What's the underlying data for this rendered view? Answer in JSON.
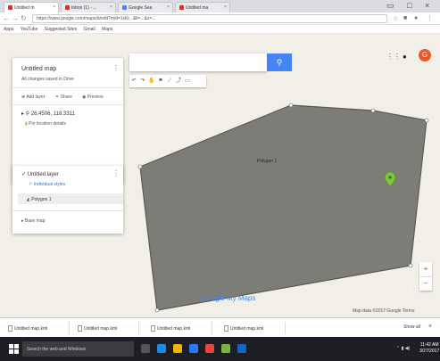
{
  "browser": {
    "tabs": [
      {
        "label": "Untitled m",
        "color": "#d93025"
      },
      {
        "label": "Inbox (1) - ...",
        "color": "#d93025"
      },
      {
        "label": "Google Sea",
        "color": "#4285f4"
      },
      {
        "label": "Untitled ma",
        "color": "#d93025"
      }
    ],
    "url": "https://www.google.com/maps/d/edit?mid=1xKr...&ll=...&z=...",
    "bookmarks": [
      "Apps",
      "YouTube",
      "Suggested Sites",
      "Gmail",
      "Maps"
    ]
  },
  "map_panel": {
    "title": "Untitled map",
    "subtitle": "All changes saved in Drive",
    "actions": [
      "Add layer",
      "Share",
      "Preview"
    ],
    "item_coords": "26.4506, 118.3311",
    "item_sub": "Pin location details",
    "layer_title": "Untitled layer",
    "layer_style": "Individual styles",
    "layer_item": "Polygon 1",
    "base_map": "Base map"
  },
  "map": {
    "polygon_label": "Polygon 1",
    "google_logo": "Google My Maps",
    "attribution": "Map data ©2017 Google  Terms",
    "avatar_letter": "G",
    "zoom_in": "+",
    "zoom_out": "−",
    "help": "?",
    "colors": {
      "polygon_fill": "#7d7d77",
      "polygon_stroke": "#5a5a55",
      "pin": "#7ec63b",
      "search_button": "#4285f4"
    }
  },
  "downloads": {
    "items": [
      "Untitled map.kml",
      "Untitled map.kml",
      "Untitled map.kml",
      "Untitled map.kml"
    ],
    "show_all": "Show all"
  },
  "taskbar": {
    "search_placeholder": "Search the web and Windows",
    "time": "11:42 AM",
    "date": "3/27/2017"
  }
}
